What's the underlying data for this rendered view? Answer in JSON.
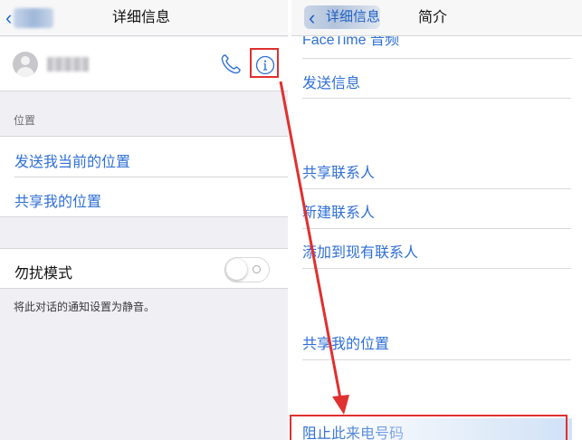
{
  "left_screen": {
    "nav": {
      "back_label": "",
      "title": "详细信息"
    },
    "contact": {
      "name": ""
    },
    "location_section": {
      "header": "位置",
      "items": [
        "发送我当前的位置",
        "共享我的位置"
      ]
    },
    "dnd": {
      "label": "勿扰模式",
      "enabled": false,
      "footnote": "将此对话的通知设置为静音。"
    }
  },
  "right_screen": {
    "nav": {
      "back_label": "详细信息",
      "title": "简介"
    },
    "items": [
      "FaceTime 音频",
      "发送信息",
      "共享联系人",
      "新建联系人",
      "添加到现有联系人",
      "共享我的位置",
      "阻止此来电号码"
    ]
  },
  "icons": [
    "chevron-left-icon",
    "contact-avatar-icon",
    "phone-icon",
    "info-icon",
    "toggle-switch"
  ],
  "colors": {
    "ios_blue": "#2f6fd6",
    "annotation_red": "#e0302f",
    "grouped_bg": "#efeff4"
  }
}
